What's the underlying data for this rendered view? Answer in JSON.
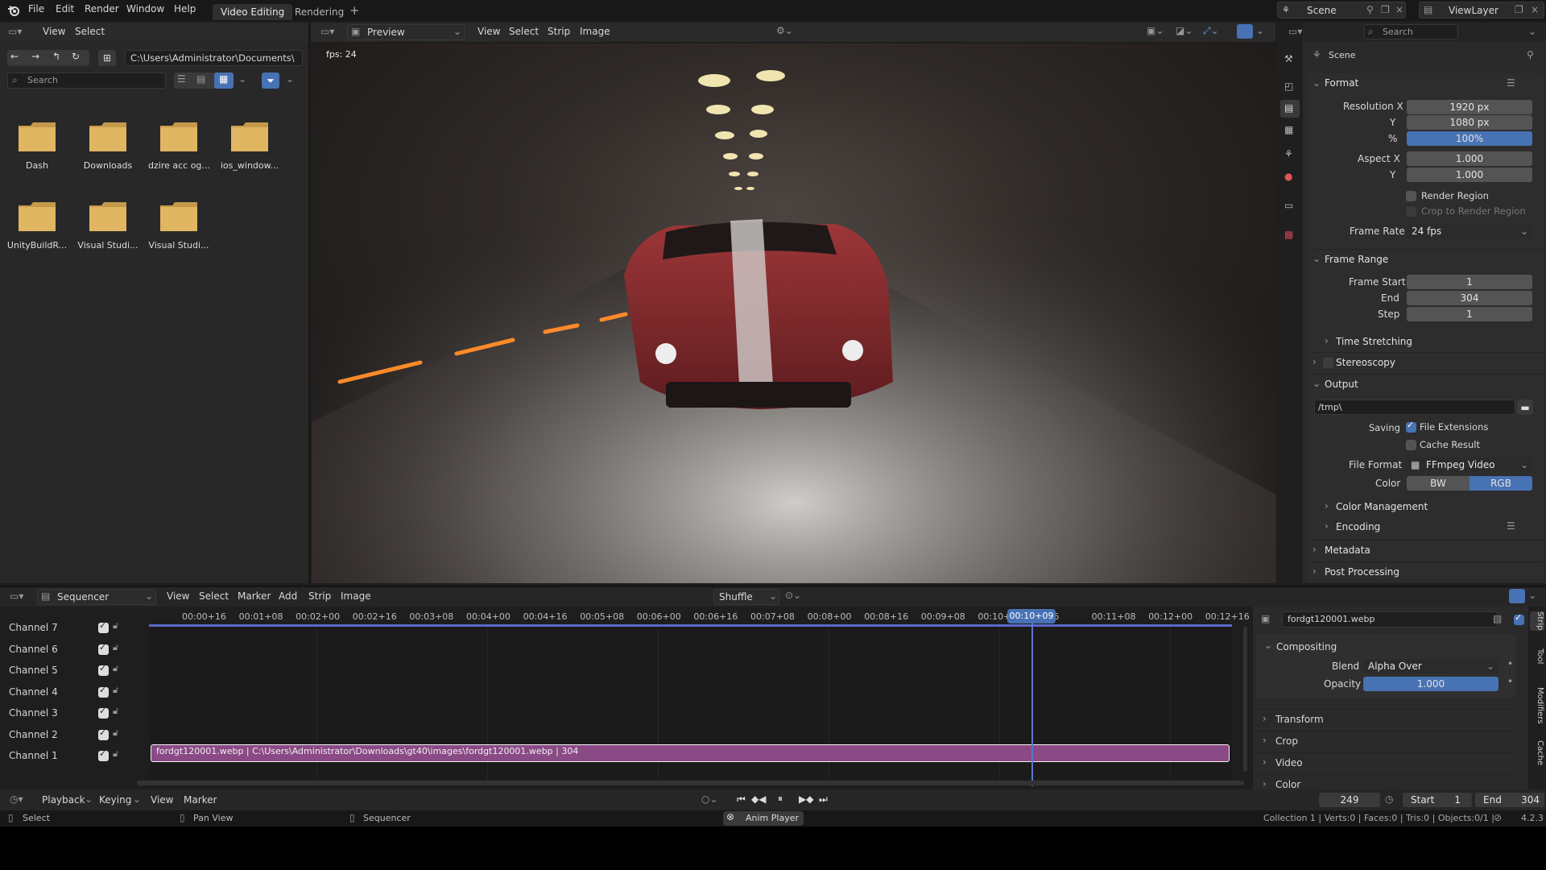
{
  "topbar": {
    "menus": [
      "File",
      "Edit",
      "Render",
      "Window",
      "Help"
    ],
    "workspaces": [
      "Video Editing",
      "Rendering"
    ],
    "scene": "Scene",
    "viewlayer": "ViewLayer"
  },
  "filebrowser": {
    "menus": [
      "View",
      "Select"
    ],
    "path": "C:\\Users\\Administrator\\Documents\\",
    "search_placeholder": "Search",
    "folders": [
      "Dash",
      "Downloads",
      "dzire acc og...",
      "ios_window...",
      "UnityBuildR...",
      "Visual Studi...",
      "Visual Studi..."
    ]
  },
  "preview": {
    "mode": "Preview",
    "menus": [
      "View",
      "Select",
      "Strip",
      "Image"
    ],
    "fps": "fps: 24"
  },
  "properties": {
    "search_placeholder": "Search",
    "context": "Scene",
    "format": {
      "title": "Format",
      "res_x_label": "Resolution X",
      "res_x": "1920 px",
      "res_y_label": "Y",
      "res_y": "1080 px",
      "pct_label": "%",
      "pct": "100%",
      "aspect_x_label": "Aspect X",
      "aspect_x": "1.000",
      "aspect_y_label": "Y",
      "aspect_y": "1.000",
      "render_region": "Render Region",
      "crop": "Crop to Render Region",
      "framerate_label": "Frame Rate",
      "framerate": "24 fps"
    },
    "frame_range": {
      "title": "Frame Range",
      "start_label": "Frame Start",
      "start": "1",
      "end_label": "End",
      "end": "304",
      "step_label": "Step",
      "step": "1",
      "time_stretching": "Time Stretching"
    },
    "stereoscopy": "Stereoscopy",
    "output": {
      "title": "Output",
      "path": "/tmp\\",
      "saving_label": "Saving",
      "file_ext": "File Extensions",
      "cache": "Cache Result",
      "format_label": "File Format",
      "format": "FFmpeg Video",
      "color_label": "Color",
      "bw": "BW",
      "rgb": "RGB",
      "color_mgmt": "Color Management",
      "encoding": "Encoding"
    },
    "metadata": "Metadata",
    "post": "Post Processing"
  },
  "sequencer": {
    "mode": "Sequencer",
    "menus": [
      "View",
      "Select",
      "Marker",
      "Add",
      "Strip",
      "Image"
    ],
    "pivot": "Shuffle",
    "ticks": [
      "00:00+16",
      "00:01+08",
      "00:02+00",
      "00:02+16",
      "00:03+08",
      "00:04+00",
      "00:04+16",
      "00:05+08",
      "00:06+00",
      "00:06+16",
      "00:07+08",
      "00:08+00",
      "00:08+16",
      "00:09+08",
      "00:10+",
      "0+16",
      "00:11+08",
      "00:12+00",
      "00:12+16"
    ],
    "current_time": "00:10+09",
    "channels": [
      "Channel 7",
      "Channel 6",
      "Channel 5",
      "Channel 4",
      "Channel 3",
      "Channel 2",
      "Channel 1"
    ],
    "strip": "fordgt120001.webp | C:\\Users\\Administrator\\Downloads\\gt40\\images\\fordgt120001.webp | 304"
  },
  "strip_panel": {
    "name": "fordgt120001.webp",
    "compositing": "Compositing",
    "blend_label": "Blend",
    "blend": "Alpha Over",
    "opacity_label": "Opacity",
    "opacity": "1.000",
    "sections": [
      "Transform",
      "Crop",
      "Video",
      "Color"
    ],
    "side_tabs": [
      "Strip",
      "Tool",
      "Modifiers",
      "Cache"
    ]
  },
  "timeline": {
    "menus": [
      "Playback",
      "Keying",
      "View",
      "Marker"
    ],
    "frame": "249",
    "start_label": "Start",
    "start": "1",
    "end_label": "End",
    "end": "304"
  },
  "statusbar": {
    "select": "Select",
    "pan": "Pan View",
    "seq": "Sequencer",
    "anim": "Anim Player",
    "stats": "Collection 1 | Verts:0 | Faces:0 | Tris:0 | Objects:0/1 |",
    "version": "4.2.3"
  },
  "colors": {
    "accent": "#4772b3",
    "strip": "#8a4a85",
    "playhead": "#5a79c9"
  }
}
